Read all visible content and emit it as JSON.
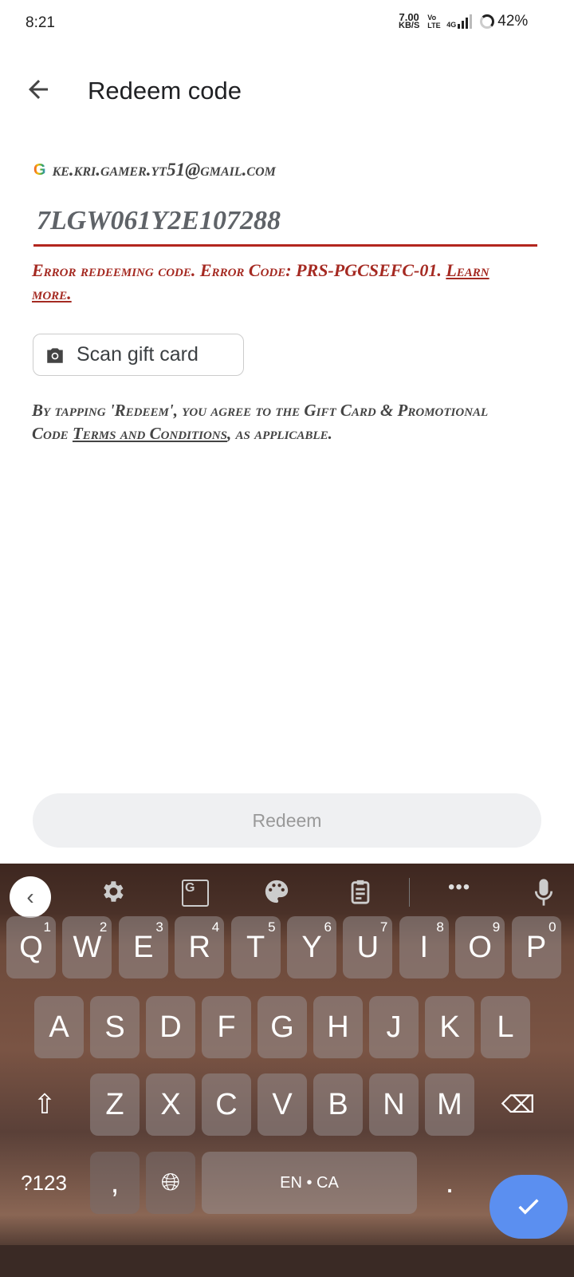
{
  "status": {
    "time": "8:21",
    "net_speed": "7.00",
    "net_unit": "KB/S",
    "volte": "Vo LTE",
    "network": "4G",
    "battery": "42%"
  },
  "header": {
    "title": "Redeem code",
    "back_icon": "arrow-left-icon"
  },
  "account": {
    "email": "ke.kri.gamer.yt51@gmail.com",
    "icon": "google-icon"
  },
  "code_input": {
    "value": "7LGW061Y2E107288"
  },
  "error": {
    "text": "Error redeeming code. Error Code: PRS-PGCSEFC-01.",
    "link": "Learn more.",
    "color": "#a52a22"
  },
  "scan_button": {
    "label": "Scan gift card",
    "icon": "camera-icon"
  },
  "terms": {
    "before": "By tapping 'Redeem', you agree to the Gift Card & Promotional Code ",
    "link": "Terms and Conditions",
    "after": ", as applicable."
  },
  "redeem_button": {
    "label": "Redeem"
  },
  "keyboard": {
    "rows": [
      [
        "Q",
        "W",
        "E",
        "R",
        "T",
        "Y",
        "U",
        "I",
        "O",
        "P"
      ],
      [
        "A",
        "S",
        "D",
        "F",
        "G",
        "H",
        "J",
        "K",
        "L"
      ],
      [
        "Z",
        "X",
        "C",
        "V",
        "B",
        "N",
        "M"
      ]
    ],
    "numbers": [
      "1",
      "2",
      "3",
      "4",
      "5",
      "6",
      "7",
      "8",
      "9",
      "0"
    ],
    "symbols_key": "?123",
    "comma": ",",
    "period": ".",
    "space_label": "EN • CA",
    "enter_color": "#5b8ff0"
  }
}
